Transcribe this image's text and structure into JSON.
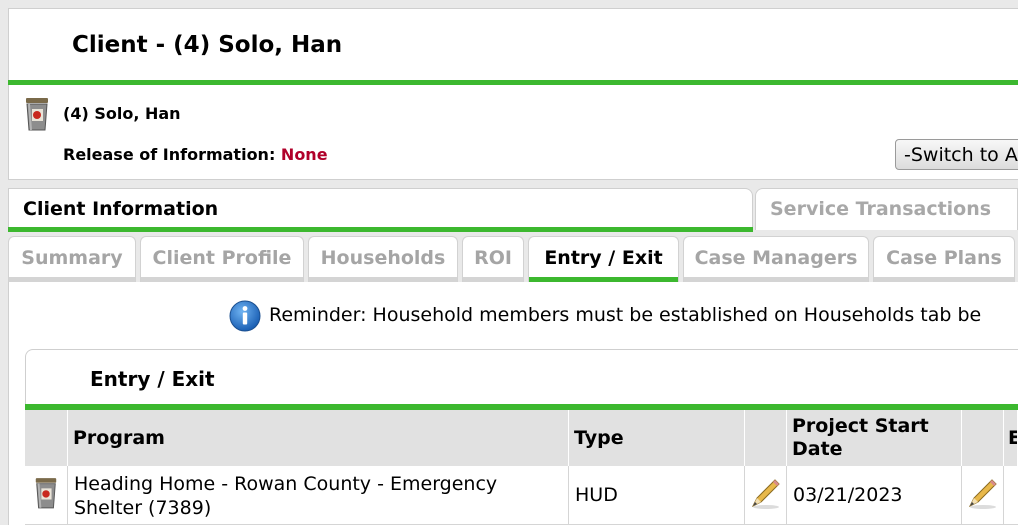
{
  "header": {
    "title": "Client - (4) Solo, Han",
    "client_name": "(4) Solo, Han",
    "roi_label": "Release of Information:",
    "roi_value": "None",
    "switch_button": "-Switch to A"
  },
  "main_tabs": [
    {
      "label": "Client Information",
      "active": true
    },
    {
      "label": "Service Transactions",
      "active": false
    }
  ],
  "sub_tabs": [
    {
      "label": "Summary",
      "active": false
    },
    {
      "label": "Client Profile",
      "active": false
    },
    {
      "label": "Households",
      "active": false
    },
    {
      "label": "ROI",
      "active": false
    },
    {
      "label": "Entry / Exit",
      "active": true
    },
    {
      "label": "Case Managers",
      "active": false
    },
    {
      "label": "Case Plans",
      "active": false
    }
  ],
  "reminder": "Reminder: Household members must be established on Households tab be",
  "section": {
    "title": "Entry / Exit",
    "columns": [
      "Program",
      "Type",
      "Project Start Date",
      "E"
    ],
    "rows": [
      {
        "program": "Heading Home - Rowan County - Emergency Shelter (7389)",
        "type": "HUD",
        "start_date": "03/21/2023"
      }
    ]
  },
  "colors": {
    "accent": "#3cb82f",
    "roi_none": "#b0002a",
    "inactive_tab": "#a5a5a5"
  },
  "icons": [
    "trash-icon",
    "info-icon",
    "edit-pencil-icon"
  ]
}
